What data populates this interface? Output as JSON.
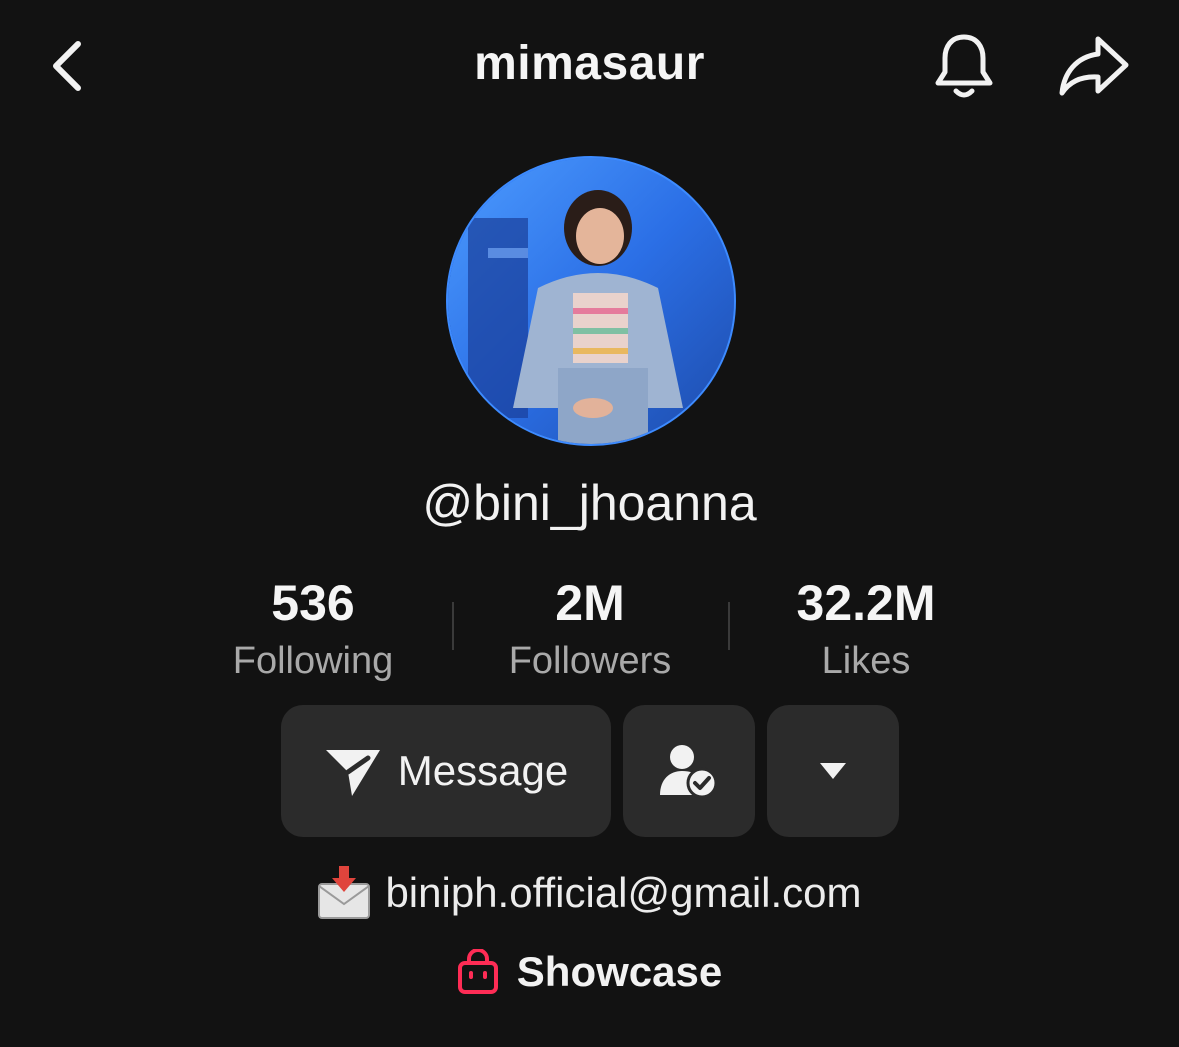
{
  "header": {
    "title": "mimasaur",
    "back_icon": "chevron-left-icon",
    "bell_icon": "bell-icon",
    "share_icon": "share-arrow-icon"
  },
  "profile": {
    "handle": "@bini_jhoanna",
    "avatar_ring_color": "#3d8bff"
  },
  "stats": [
    {
      "value": "536",
      "label": "Following"
    },
    {
      "value": "2M",
      "label": "Followers"
    },
    {
      "value": "32.2M",
      "label": "Likes"
    }
  ],
  "actions": {
    "message_label": "Message",
    "message_icon": "send-icon",
    "friend_icon": "user-check-icon",
    "more_icon": "caret-down-icon"
  },
  "bio": {
    "email_icon": "inbox-envelope-icon",
    "email": "biniph.official@gmail.com",
    "showcase_icon": "shopping-bag-icon",
    "showcase_label": "Showcase",
    "showcase_icon_color": "#fe2c55"
  }
}
